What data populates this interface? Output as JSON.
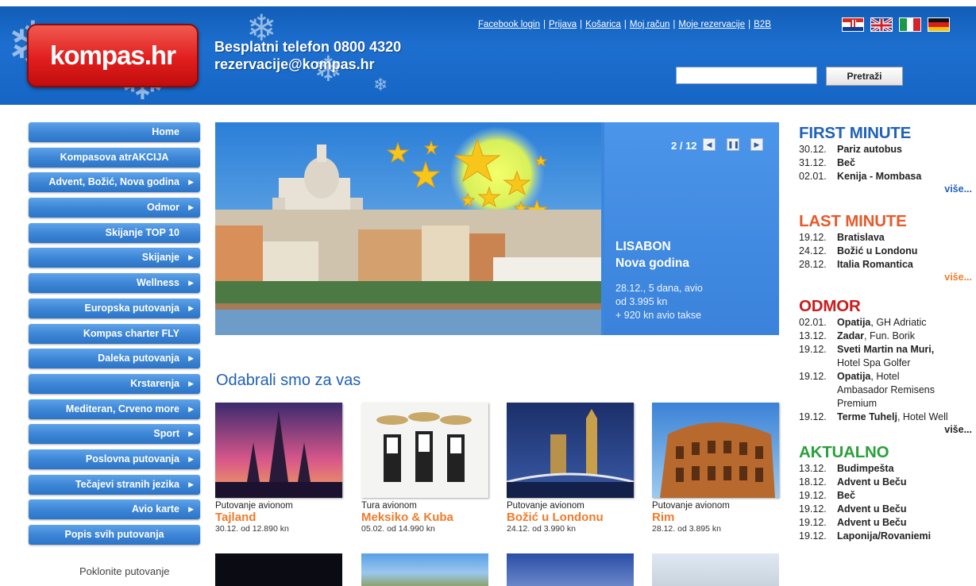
{
  "header": {
    "logo": "kompas.hr",
    "phone": "Besplatni telefon 0800 4320",
    "email": "rezervacije@kompas.hr",
    "links": [
      "Facebook login",
      "Prijava",
      "Košarica",
      "Moj račun",
      "Moje rezervacije",
      "B2B"
    ],
    "languages": [
      "hr",
      "en",
      "it",
      "de"
    ],
    "search_placeholder": "",
    "search_button": "Pretraži"
  },
  "nav": {
    "items": [
      {
        "label": "Home",
        "arrow": false
      },
      {
        "label": "Kompasova atrAKCIJA",
        "arrow": false
      },
      {
        "label": "Advent, Božić, Nova godina",
        "arrow": true
      },
      {
        "label": "Odmor",
        "arrow": true
      },
      {
        "label": "Skijanje TOP 10",
        "arrow": false
      },
      {
        "label": "Skijanje",
        "arrow": true
      },
      {
        "label": "Wellness",
        "arrow": true
      },
      {
        "label": "Europska putovanja",
        "arrow": true
      },
      {
        "label": "Kompas charter FLY",
        "arrow": false
      },
      {
        "label": "Daleka putovanja",
        "arrow": true
      },
      {
        "label": "Krstarenja",
        "arrow": true
      },
      {
        "label": "Mediteran, Crveno more",
        "arrow": true
      },
      {
        "label": "Sport",
        "arrow": true
      },
      {
        "label": "Poslovna putovanja",
        "arrow": true
      },
      {
        "label": "Tečajevi stranih jezika",
        "arrow": true
      },
      {
        "label": "Avio karte",
        "arrow": true
      },
      {
        "label": "Popis svih putovanja",
        "arrow": false
      }
    ],
    "gift": "Poklonite putovanje"
  },
  "slider": {
    "counter": "2 / 12",
    "title1": "LISABON",
    "title2": "Nova godina",
    "info1": "28.12., 5 dana, avio",
    "info2": "od 3.995 kn",
    "info3": "+ 920 kn avio takse"
  },
  "picks": {
    "title": "Odabrali smo za vas",
    "cards": [
      {
        "type": "Putovanje avionom",
        "name": "Tajland",
        "date": "30.12. od 12.890 kn"
      },
      {
        "type": "Tura avionom",
        "name": "Meksiko & Kuba",
        "date": "05.02. od 14.990 kn"
      },
      {
        "type": "Putovanje avionom",
        "name": "Božić u Londonu",
        "date": "24.12. od 3.990 kn"
      },
      {
        "type": "Putovanje avionom",
        "name": "Rim",
        "date": "28.12. od 3.895 kn"
      }
    ]
  },
  "right": {
    "first_minute": {
      "title": "FIRST MINUTE",
      "items": [
        {
          "date": "30.12.",
          "name": "Pariz autobus",
          "extra": ""
        },
        {
          "date": "31.12.",
          "name": "Beč",
          "extra": ""
        },
        {
          "date": "02.01.",
          "name": "Kenija - Mombasa",
          "extra": ""
        }
      ],
      "more": "više..."
    },
    "last_minute": {
      "title": "LAST MINUTE",
      "items": [
        {
          "date": "19.12.",
          "name": "Bratislava",
          "extra": ""
        },
        {
          "date": "24.12.",
          "name": "Božić u Londonu",
          "extra": ""
        },
        {
          "date": "28.12.",
          "name": "Italia Romantica",
          "extra": ""
        }
      ],
      "more": "više..."
    },
    "odmor": {
      "title": "ODMOR",
      "items": [
        {
          "date": "02.01.",
          "name": "Opatija",
          "extra": ", GH Adriatic"
        },
        {
          "date": "13.12.",
          "name": "Zadar",
          "extra": ", Fun. Borik"
        },
        {
          "date": "19.12.",
          "name": "Sveti Martin na Muri,",
          "extra": ""
        },
        {
          "date": "",
          "name": "",
          "extra": "Hotel Spa Golfer"
        },
        {
          "date": "19.12.",
          "name": "Opatija",
          "extra": ", Hotel"
        },
        {
          "date": "",
          "name": "",
          "extra": "Ambasador Remisens"
        },
        {
          "date": "",
          "name": "",
          "extra": "Premium"
        },
        {
          "date": "19.12.",
          "name": "Terme Tuhelj",
          "extra": ", Hotel Well"
        }
      ],
      "more": "više..."
    },
    "aktualno": {
      "title": "AKTUALNO",
      "items": [
        {
          "date": "13.12.",
          "name": "Budimpešta",
          "extra": ""
        },
        {
          "date": "18.12.",
          "name": "Advent u Beču",
          "extra": ""
        },
        {
          "date": "19.12.",
          "name": "Beč",
          "extra": ""
        },
        {
          "date": "19.12.",
          "name": "Advent u Beču",
          "extra": ""
        },
        {
          "date": "19.12.",
          "name": "Advent u Beču",
          "extra": ""
        },
        {
          "date": "19.12.",
          "name": "Laponija/Rovaniemi",
          "extra": ""
        }
      ]
    }
  }
}
